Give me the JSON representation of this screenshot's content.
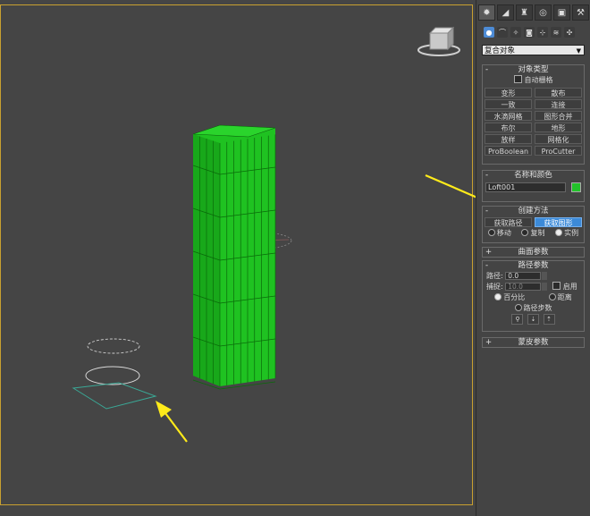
{
  "viewport": {
    "label": "Perspective viewport",
    "model_color": "#1fc221",
    "arrow_color": "#ffeb1a"
  },
  "tabs": [
    "create-icon",
    "modify-icon",
    "hierarchy-icon",
    "motion-icon",
    "display-icon",
    "utilities-icon"
  ],
  "categories": [
    "geometry-icon",
    "shapes-icon",
    "lights-icon",
    "cameras-icon",
    "helpers-icon",
    "spacewarps-icon",
    "systems-icon"
  ],
  "object_dropdown": "复合对象",
  "object_type": {
    "title": "对象类型",
    "autogrid_label": "自动栅格",
    "buttons": [
      "变形",
      "散布",
      "一致",
      "连接",
      "水滴网格",
      "图形合并",
      "布尔",
      "地形",
      "放样",
      "网格化",
      "ProBoolean",
      "ProCutter"
    ]
  },
  "name_color": {
    "title": "名称和颜色",
    "name_value": "Loft001",
    "color": "#22c22a"
  },
  "creation_method": {
    "title": "创建方法",
    "get_path": "获取路径",
    "get_shape": "获取图形",
    "options": [
      "移动",
      "复制",
      "实例"
    ]
  },
  "surface_params": {
    "title": "曲面参数"
  },
  "path_params": {
    "title": "路径参数",
    "path_label": "路径:",
    "path_value": "0.0",
    "snap_label": "捕捉:",
    "snap_value": "10.0",
    "enable_label": "启用",
    "percent_label": "百分比",
    "distance_label": "距离",
    "steps_label": "路径步数"
  },
  "skin_params": {
    "title": "蒙皮参数"
  }
}
